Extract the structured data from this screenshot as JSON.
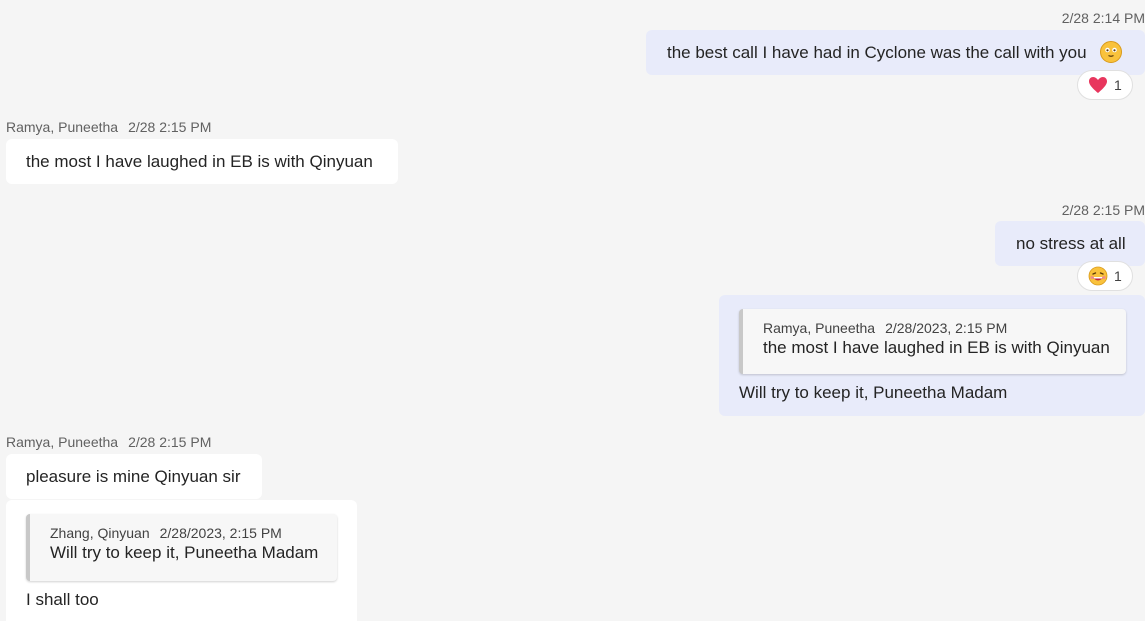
{
  "messages": [
    {
      "timestamp": "2/28 2:14 PM",
      "text": "the best call I have had in Cyclone was the call with you",
      "emoji": "smile-emoji",
      "reaction": {
        "icon": "heart-emoji",
        "count": "1"
      }
    },
    {
      "sender": "Ramya, Puneetha",
      "timestamp": "2/28 2:15 PM",
      "text": "the most I have laughed in EB is with Qinyuan"
    },
    {
      "timestamp": "2/28 2:15 PM",
      "text": "no stress at all",
      "reaction": {
        "icon": "laughing-emoji",
        "count": "1"
      }
    },
    {
      "quote": {
        "sender": "Ramya, Puneetha",
        "timestamp": "2/28/2023, 2:15 PM",
        "text": "the most I have laughed in EB is with Qinyuan"
      },
      "text": "Will try to keep it, Puneetha Madam"
    },
    {
      "sender": "Ramya, Puneetha",
      "timestamp": "2/28 2:15 PM",
      "text": "pleasure is mine Qinyuan sir"
    },
    {
      "quote": {
        "sender": "Zhang, Qinyuan",
        "timestamp": "2/28/2023, 2:15 PM",
        "text": "Will try to keep it, Puneetha Madam"
      },
      "text": "I shall too"
    }
  ],
  "colors": {
    "background": "#f5f5f5",
    "own_bubble": "#e8ebfa",
    "other_bubble": "#ffffff"
  }
}
